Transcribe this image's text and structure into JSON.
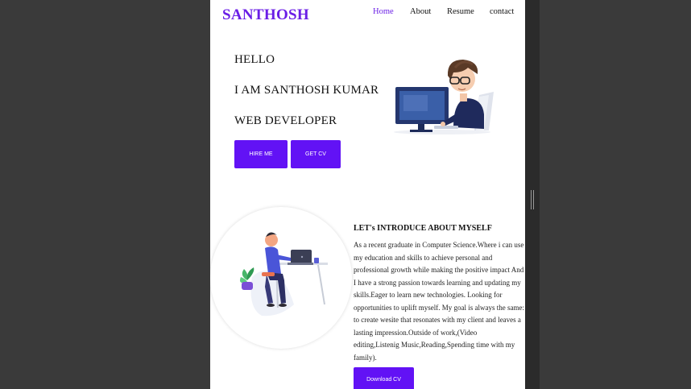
{
  "header": {
    "brand": "SANTHOSH",
    "nav": [
      "Home",
      "About",
      "Resume",
      "contact"
    ]
  },
  "hero": {
    "line1": "HELLO",
    "line2": "I AM SANTHOSH KUMAR",
    "line3": "WEB DEVELOPER",
    "hire_button": "HIRE ME",
    "cv_button": "GET CV"
  },
  "about": {
    "title": "LET's INTRODUCE ABOUT MYSELF",
    "body": "As a recent graduate in Computer Science.Where i can use my education and skills to achieve personal and professional growth while making the positive impact And I have a strong passion towards learning and updating my skills.Eager to learn new technologies. Looking for opportunities to uplift myself. My goal is always the same: to create wesite that resonates with my client and leaves a lasting impression.Outside of work,(Video editing,Listenig Music,Reading,Spending time with my family).",
    "download_button": "Download CV"
  },
  "colors": {
    "accent": "#6a1ee6",
    "button": "#6212f5"
  }
}
